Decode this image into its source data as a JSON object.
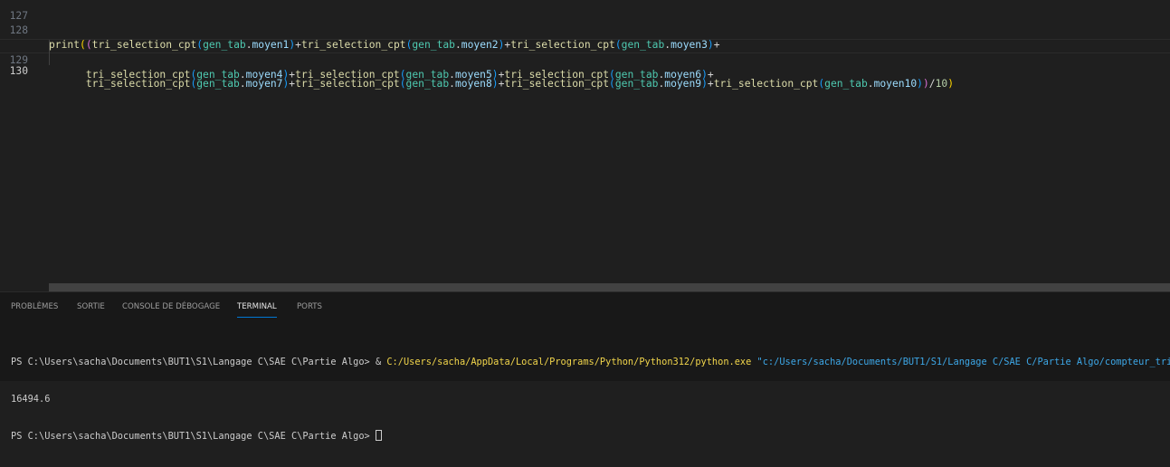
{
  "editor": {
    "line_numbers": [
      "127",
      "128",
      "129",
      "130"
    ],
    "current_line": "130",
    "lines": [
      {
        "parts": []
      },
      {
        "parts": [
          {
            "t": "print",
            "c": "fn"
          },
          {
            "t": "(",
            "c": "p1"
          },
          {
            "t": "(",
            "c": "p2"
          },
          {
            "t": "tri_selection_cpt",
            "c": "fn"
          },
          {
            "t": "(",
            "c": "p3"
          },
          {
            "t": "gen_tab",
            "c": "var"
          },
          {
            "t": ".",
            "c": "op"
          },
          {
            "t": "moyen1",
            "c": "prop"
          },
          {
            "t": ")",
            "c": "p3"
          },
          {
            "t": "+",
            "c": "op"
          },
          {
            "t": "tri_selection_cpt",
            "c": "fn"
          },
          {
            "t": "(",
            "c": "p3"
          },
          {
            "t": "gen_tab",
            "c": "var"
          },
          {
            "t": ".",
            "c": "op"
          },
          {
            "t": "moyen2",
            "c": "prop"
          },
          {
            "t": ")",
            "c": "p3"
          },
          {
            "t": "+",
            "c": "op"
          },
          {
            "t": "tri_selection_cpt",
            "c": "fn"
          },
          {
            "t": "(",
            "c": "p3"
          },
          {
            "t": "gen_tab",
            "c": "var"
          },
          {
            "t": ".",
            "c": "op"
          },
          {
            "t": "moyen3",
            "c": "prop"
          },
          {
            "t": ")",
            "c": "p3"
          },
          {
            "t": "+",
            "c": "op"
          }
        ]
      },
      {
        "parts": [
          {
            "t": "      ",
            "c": "op"
          },
          {
            "t": "tri_selection_cpt",
            "c": "fn"
          },
          {
            "t": "(",
            "c": "p3"
          },
          {
            "t": "gen_tab",
            "c": "var"
          },
          {
            "t": ".",
            "c": "op"
          },
          {
            "t": "moyen4",
            "c": "prop"
          },
          {
            "t": ")",
            "c": "p3"
          },
          {
            "t": "+",
            "c": "op"
          },
          {
            "t": "tri_selection_cpt",
            "c": "fn"
          },
          {
            "t": "(",
            "c": "p3"
          },
          {
            "t": "gen_tab",
            "c": "var"
          },
          {
            "t": ".",
            "c": "op"
          },
          {
            "t": "moyen5",
            "c": "prop"
          },
          {
            "t": ")",
            "c": "p3"
          },
          {
            "t": "+",
            "c": "op"
          },
          {
            "t": "tri_selection_cpt",
            "c": "fn"
          },
          {
            "t": "(",
            "c": "p3"
          },
          {
            "t": "gen_tab",
            "c": "var"
          },
          {
            "t": ".",
            "c": "op"
          },
          {
            "t": "moyen6",
            "c": "prop"
          },
          {
            "t": ")",
            "c": "p3"
          },
          {
            "t": "+",
            "c": "op"
          }
        ]
      },
      {
        "parts": [
          {
            "t": "      ",
            "c": "op"
          },
          {
            "t": "tri_selection_cpt",
            "c": "fn"
          },
          {
            "t": "(",
            "c": "p3"
          },
          {
            "t": "gen_tab",
            "c": "var"
          },
          {
            "t": ".",
            "c": "op"
          },
          {
            "t": "moyen7",
            "c": "prop"
          },
          {
            "t": ")",
            "c": "p3"
          },
          {
            "t": "+",
            "c": "op"
          },
          {
            "t": "tri_selection_cpt",
            "c": "fn"
          },
          {
            "t": "(",
            "c": "p3"
          },
          {
            "t": "gen_tab",
            "c": "var"
          },
          {
            "t": ".",
            "c": "op"
          },
          {
            "t": "moyen8",
            "c": "prop"
          },
          {
            "t": ")",
            "c": "p3"
          },
          {
            "t": "+",
            "c": "op"
          },
          {
            "t": "tri_selection_cpt",
            "c": "fn"
          },
          {
            "t": "(",
            "c": "p3"
          },
          {
            "t": "gen_tab",
            "c": "var"
          },
          {
            "t": ".",
            "c": "op"
          },
          {
            "t": "moyen9",
            "c": "prop"
          },
          {
            "t": ")",
            "c": "p3"
          },
          {
            "t": "+",
            "c": "op"
          },
          {
            "t": "tri_selection_cpt",
            "c": "fn"
          },
          {
            "t": "(",
            "c": "p3"
          },
          {
            "t": "gen_tab",
            "c": "var"
          },
          {
            "t": ".",
            "c": "op"
          },
          {
            "t": "moyen10",
            "c": "prop"
          },
          {
            "t": ")",
            "c": "p3"
          },
          {
            "t": ")",
            "c": "p2"
          },
          {
            "t": "/",
            "c": "op"
          },
          {
            "t": "10",
            "c": "num"
          },
          {
            "t": ")",
            "c": "p1"
          }
        ]
      }
    ]
  },
  "panel": {
    "tabs": [
      {
        "label": "PROBLÈMES",
        "active": false
      },
      {
        "label": "SORTIE",
        "active": false
      },
      {
        "label": "CONSOLE DE DÉBOGAGE",
        "active": false
      },
      {
        "label": "TERMINAL",
        "active": true
      },
      {
        "label": "PORTS",
        "active": false
      }
    ]
  },
  "terminal": {
    "prompt": "PS C:\\Users\\sacha\\Documents\\BUT1\\S1\\Langage C\\SAE C\\Partie Algo> ",
    "call_operator": "& ",
    "python_path": "C:/Users/sacha/AppData/Local/Programs/Python/Python312/python.exe",
    "script_arg": "\"c:/Users/sacha/Documents/BUT1/S1/Langage C/SAE C/Partie Algo/compteur_tris.py\"",
    "output": "16494.6",
    "prompt2": "PS C:\\Users\\sacha\\Documents\\BUT1\\S1\\Langage C\\SAE C\\Partie Algo> "
  },
  "colors": {
    "editor_bg": "#1f1f1f",
    "panel_bg": "#181818",
    "active_tab_underline": "#0078d4",
    "function": "#dcdcaa",
    "variable": "#4ec9b0",
    "property": "#9cdcfe",
    "bracket1": "#ffd700",
    "bracket2": "#da70d6",
    "bracket3": "#179fff"
  }
}
